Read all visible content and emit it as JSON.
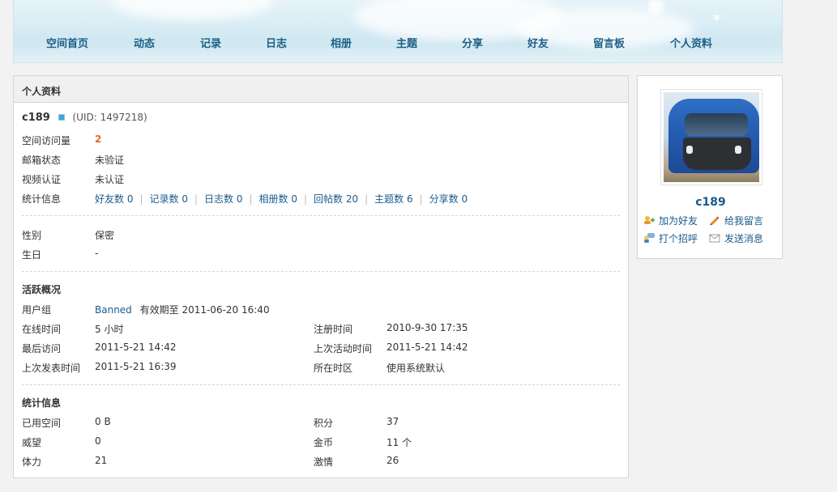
{
  "nav": {
    "items": [
      "空间首页",
      "动态",
      "记录",
      "日志",
      "相册",
      "主题",
      "分享",
      "好友",
      "留言板",
      "个人资料"
    ]
  },
  "panel": {
    "title": "个人资料",
    "username": "c189",
    "uid": "(UID: 1497218)",
    "basic": [
      {
        "label": "空间访问量",
        "value": "2"
      },
      {
        "label": "邮箱状态",
        "value": "未验证"
      },
      {
        "label": "视频认证",
        "value": "未认证"
      }
    ],
    "stats_label": "统计信息",
    "stats": [
      "好友数 0",
      "记录数 0",
      "日志数 0",
      "相册数 0",
      "回帖数 20",
      "主题数 6",
      "分享数 0"
    ],
    "personal": [
      {
        "label": "性别",
        "value": "保密"
      },
      {
        "label": "生日",
        "value": "-"
      }
    ],
    "activity_title": "活跃概况",
    "usergroup_label": "用户组",
    "usergroup_link": "Banned",
    "usergroup_expire": "有效期至 2011-06-20 16:40",
    "activity": [
      {
        "l1": "在线时间",
        "v1": "5 小时",
        "l2": "注册时间",
        "v2": "2010-9-30 17:35"
      },
      {
        "l1": "最后访问",
        "v1": "2011-5-21 14:42",
        "l2": "上次活动时间",
        "v2": "2011-5-21 14:42"
      },
      {
        "l1": "上次发表时间",
        "v1": "2011-5-21 16:39",
        "l2": "所在时区",
        "v2": "使用系统默认"
      }
    ],
    "stats2_title": "统计信息",
    "stats2": [
      {
        "l1": "已用空间",
        "v1": "0 B",
        "l2": "积分",
        "v2": "37"
      },
      {
        "l1": "威望",
        "v1": "0",
        "l2": "金币",
        "v2": "11 个"
      },
      {
        "l1": "体力",
        "v1": "21",
        "l2": "激情",
        "v2": "26"
      }
    ]
  },
  "side": {
    "name": "c189",
    "add_friend": "加为好友",
    "leave_message": "给我留言",
    "greet": "打个招呼",
    "send_message": "发送消息"
  },
  "colors": {
    "accent": "#1a5a8c",
    "visit_count": "#e06a2c"
  }
}
